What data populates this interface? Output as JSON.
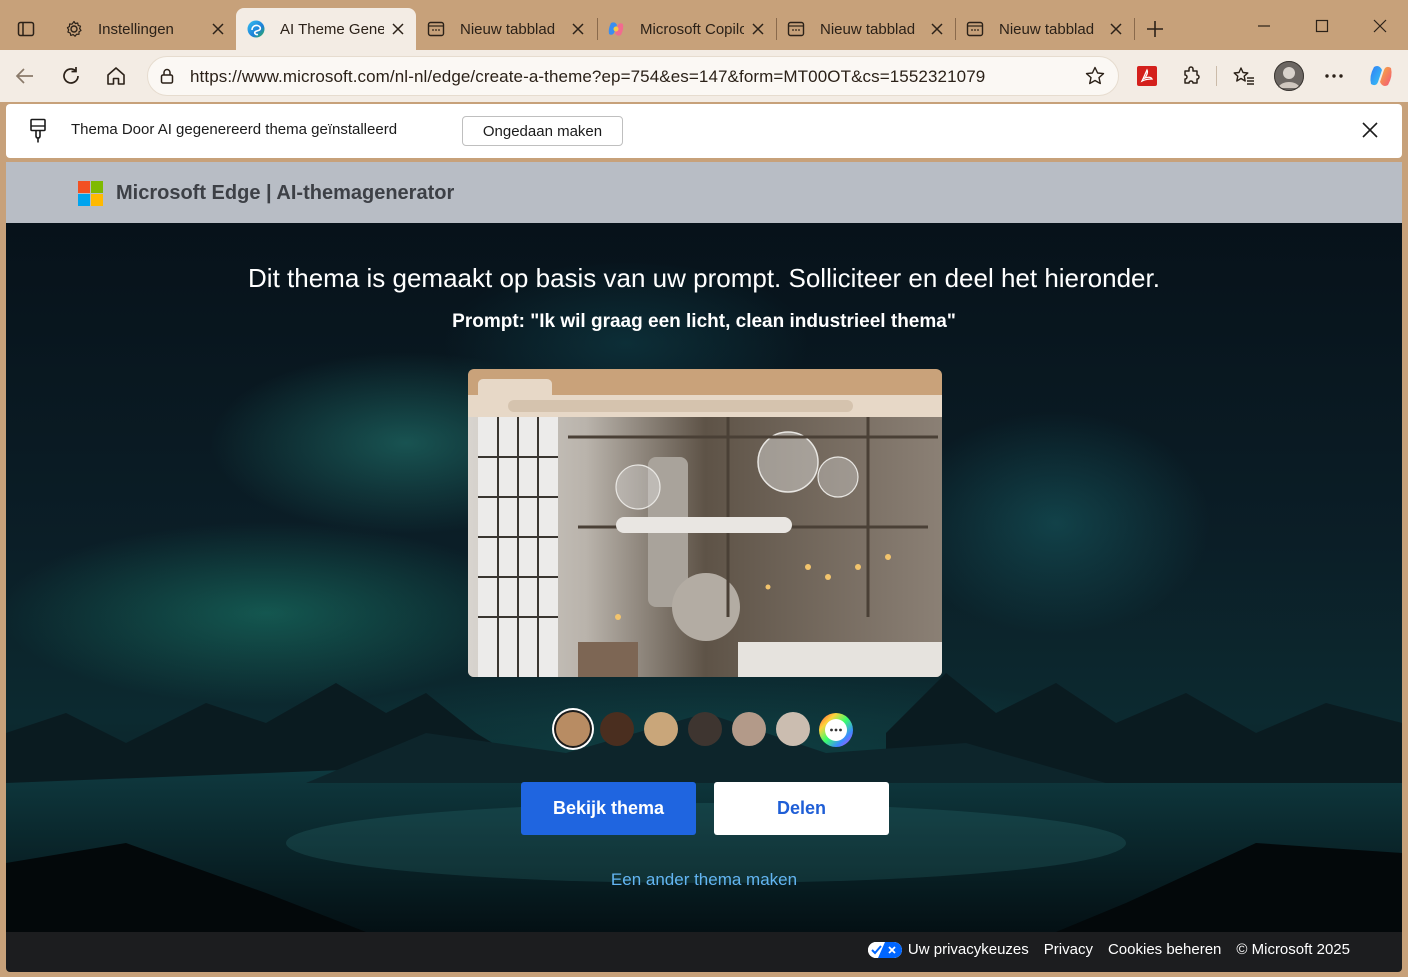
{
  "colors": {
    "frame": "#c7a17a",
    "toolbar": "#f3ece4",
    "primary_button": "#1f65e0",
    "link": "#63b5f2",
    "footer": "#1c1d1f"
  },
  "tabs": [
    {
      "label": "Instellingen",
      "icon": "gear-icon",
      "active": false
    },
    {
      "label": "AI Theme Generator",
      "icon": "edge-icon",
      "active": true
    },
    {
      "label": "Nieuw tabblad",
      "icon": "new-tab-icon",
      "active": false
    },
    {
      "label": "Microsoft Copilot",
      "icon": "copilot-icon",
      "active": false
    },
    {
      "label": "Nieuw tabblad",
      "icon": "new-tab-icon",
      "active": false
    },
    {
      "label": "Nieuw tabblad",
      "icon": "new-tab-icon",
      "active": false
    }
  ],
  "toolbar": {
    "url": "https://www.microsoft.com/nl-nl/edge/create-a-theme?ep=754&es=147&form=MT00OT&cs=1552321079"
  },
  "notification": {
    "message": "Thema Door AI gegenereerd thema geïnstalleerd",
    "undo_label": "Ongedaan maken"
  },
  "page": {
    "header_title": "Microsoft Edge | AI-themagenerator",
    "title": "Dit thema is gemaakt op basis van uw prompt. Solliciteer en deel het hieronder.",
    "prompt": "Prompt: \"Ik wil graag een licht, clean industrieel thema\"",
    "swatches": [
      "#b88c63",
      "#4a2e1f",
      "#c9a67a",
      "#3e3530",
      "#b39a89",
      "#cbbdb0"
    ],
    "selected_swatch": 0,
    "primary_button": "Bekijk thema",
    "secondary_button": "Delen",
    "alt_link": "Een ander thema maken"
  },
  "footer": {
    "privacy_choices": "Uw privacykeuzes",
    "privacy": "Privacy",
    "cookies": "Cookies beheren",
    "copyright": "© Microsoft 2025"
  }
}
